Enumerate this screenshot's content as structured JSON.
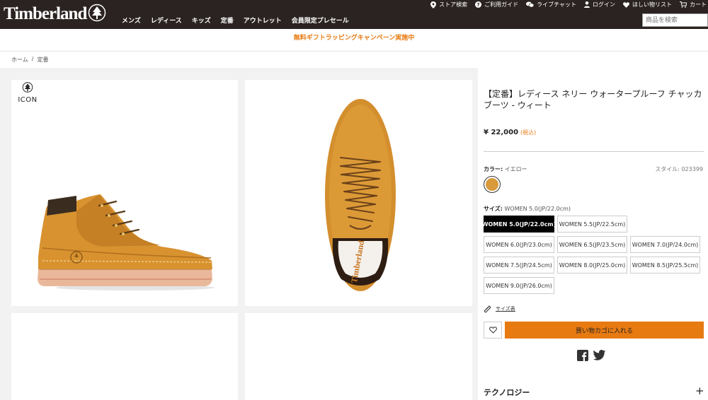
{
  "header": {
    "logo_text": "Timberland",
    "nav": [
      "メンズ",
      "レディース",
      "キッズ",
      "定番",
      "アウトレット",
      "会員限定プレセール"
    ],
    "utility": {
      "store_search": "ストア検索",
      "guide": "ご利用ガイド",
      "live_chat": "ライブチャット",
      "login": "ログイン",
      "wishlist": "ほしい物リスト",
      "cart": "カート"
    },
    "search_placeholder": "商品を検索"
  },
  "banner": "無料ギフトラッピングキャンペーン実施中",
  "breadcrumb": {
    "home": "ホーム",
    "separator": "/",
    "current": "定番"
  },
  "gallery": {
    "badge_text": "ICON"
  },
  "product": {
    "title": "【定番】レディース ネリー ウォータープルーフ チャッカブーツ - ウィート",
    "price": "¥ 22,000",
    "tax_note": "(税込)",
    "color_label": "カラー:",
    "color_value": "イエロー",
    "style_label": "スタイル: 023399",
    "swatch_color": "#d89a3b",
    "size_label": "サイズ:",
    "size_value": "WOMEN 5.0(JP/22.0cm)",
    "sizes": [
      "WOMEN 5.0(JP/22.0cm)",
      "WOMEN 5.5(JP/22.5cm)",
      "WOMEN 6.0(JP/23.0cm)",
      "WOMEN 6.5(JP/23.5cm)",
      "WOMEN 7.0(JP/24.0cm)",
      "WOMEN 7.5(JP/24.5cm)",
      "WOMEN 8.0(JP/25.0cm)",
      "WOMEN 8.5(JP/25.5cm)",
      "WOMEN 9.0(JP/26.0cm)"
    ],
    "selected_size_index": 0,
    "size_chart": "サイズ表",
    "add_to_cart": "買い物カゴに入れる",
    "technology": "テクノロジー",
    "expand_symbol": "+"
  },
  "colors": {
    "accent": "#e87a12",
    "header_bg": "#2b2321"
  }
}
